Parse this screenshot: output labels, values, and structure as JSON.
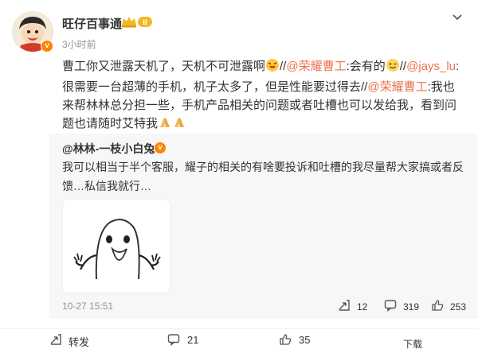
{
  "post": {
    "username": "旺仔百事通",
    "badge_level": "II",
    "time": "3小时前",
    "content": {
      "p1": "曹工你又泄露天机了，天机不可泄露啊",
      "sep1": "//",
      "m1": "@荣耀曹工",
      "t1": ":会有的",
      "sep2": "//",
      "m2": "@jays_lu",
      "t2": ":很需要一台超薄的手机，机子太多了，但是性能要过得去",
      "sep3": "//",
      "m3": "@荣耀曹工",
      "t3": ":我也来帮林林总分担一些，手机产品相关的问题或者吐槽也可以发给我，看到问题也请随时艾特我"
    }
  },
  "repost": {
    "username": "@林林-一枝小白兔",
    "text": "我可以相当于半个客服，耀子的相关的有啥要投诉和吐槽的我尽量帮大家搞或者反馈…私信我就行…",
    "time": "10-27 15:51",
    "reposts": "12",
    "comments": "319",
    "likes": "253"
  },
  "actions": {
    "repost_label": "转发",
    "comments": "21",
    "likes": "35",
    "footer_right": "下载"
  },
  "colors": {
    "link": "#eb7350",
    "muted": "#939393",
    "badge": "#ff8200",
    "repost_bg": "#f7f7f7"
  }
}
